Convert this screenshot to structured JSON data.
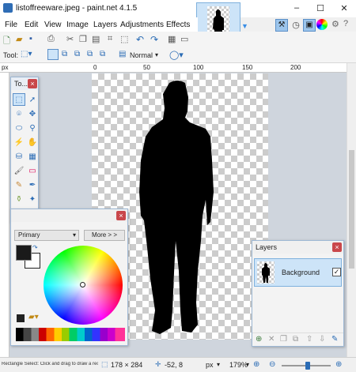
{
  "app": {
    "title": "listoffreeware.jpeg - paint.net 4.1.5"
  },
  "window_controls": {
    "minimize": "–",
    "maximize": "☐",
    "close": "✕"
  },
  "menu": {
    "items": [
      "File",
      "Edit",
      "View",
      "Image",
      "Layers",
      "Adjustments",
      "Effects"
    ]
  },
  "toolbar": {
    "tool_label": "Tool:",
    "blend_mode": "Normal"
  },
  "ruler": {
    "unit": "px",
    "marks": [
      "0",
      "50",
      "100",
      "150",
      "200"
    ]
  },
  "tools_window": {
    "title": "To..."
  },
  "colors_window": {
    "palette_mode": "Primary",
    "more_button": "More > >"
  },
  "layers_window": {
    "title": "Layers",
    "layer_name": "Background",
    "checked": true
  },
  "status": {
    "hint": "Rectangle Select: Click and drag to draw a rectan...",
    "selection_size": "178 × 284",
    "cursor_pos": "-52, 8",
    "units": "px",
    "zoom": "179%"
  },
  "colors": {
    "accent": "#0078d7",
    "close_red": "#c9474b",
    "silhouette": "#000000"
  }
}
